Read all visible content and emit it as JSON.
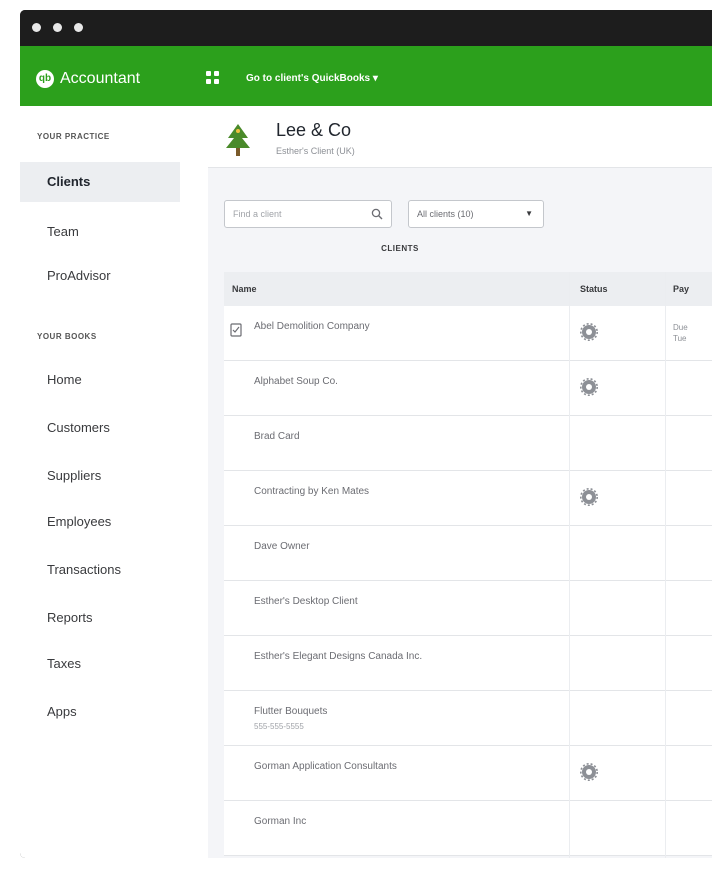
{
  "window": {
    "traffic_lights": [
      "close",
      "minimize",
      "zoom"
    ]
  },
  "appbar": {
    "logo_text": "qb",
    "brand": "Accountant",
    "company_switcher": "Go to client's QuickBooks ▾"
  },
  "sidebar": {
    "practice_heading": "YOUR PRACTICE",
    "practice_items": [
      "Clients",
      "Team",
      "ProAdvisor"
    ],
    "books_heading": "YOUR BOOKS",
    "books_items": [
      "Home",
      "Customers",
      "Suppliers",
      "Employees",
      "Transactions",
      "Reports",
      "Taxes",
      "Apps"
    ]
  },
  "client": {
    "name": "Lee & Co",
    "subtitle": "Esther's Client (UK)"
  },
  "filters": {
    "search_placeholder": "Find a client",
    "view_selected": "All clients (10)"
  },
  "tabs": {
    "clients": "CLIENTS"
  },
  "table": {
    "headers": [
      "Name",
      "Status",
      "Pay"
    ],
    "rows": [
      {
        "name": "Abel Demolition Company",
        "sub": "",
        "status_icon": true,
        "checkbox": true,
        "mtd": "Due\nTue"
      },
      {
        "name": "Alphabet Soup Co.",
        "sub": "",
        "status_icon": true,
        "checkbox": false,
        "mtd": ""
      },
      {
        "name": "Brad Card",
        "sub": "",
        "status_icon": false,
        "checkbox": false,
        "mtd": ""
      },
      {
        "name": "Contracting by Ken Mates",
        "sub": "",
        "status_icon": true,
        "checkbox": false,
        "mtd": ""
      },
      {
        "name": "Dave Owner",
        "sub": "",
        "status_icon": false,
        "checkbox": false,
        "mtd": ""
      },
      {
        "name": "Esther's Desktop Client",
        "sub": "",
        "status_icon": false,
        "checkbox": false,
        "mtd": ""
      },
      {
        "name": "Esther's Elegant Designs Canada Inc.",
        "sub": "",
        "status_icon": false,
        "checkbox": false,
        "mtd": ""
      },
      {
        "name": "Flutter Bouquets",
        "sub": "555-555-5555",
        "status_icon": false,
        "checkbox": false,
        "mtd": ""
      },
      {
        "name": "Gorman Application Consultants",
        "sub": "",
        "status_icon": true,
        "checkbox": false,
        "mtd": ""
      },
      {
        "name": "Gorman Inc",
        "sub": "",
        "status_icon": false,
        "checkbox": false,
        "mtd": ""
      }
    ]
  },
  "colors": {
    "brand_green": "#2ca01c",
    "titlebar": "#1d1d1d",
    "sidebar_active": "#eceef1"
  }
}
